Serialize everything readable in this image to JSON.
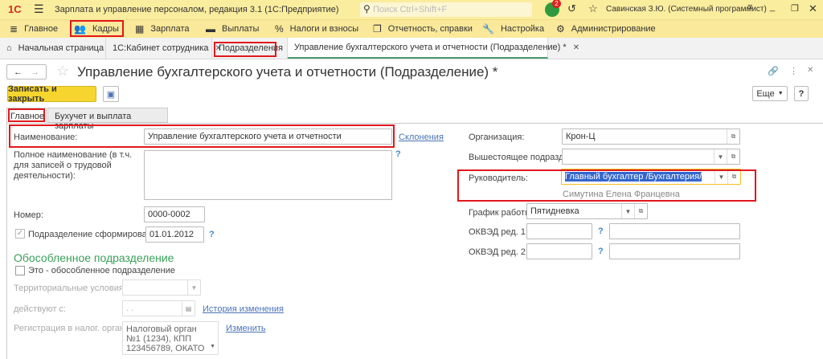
{
  "titlebar": {
    "logo": "1С",
    "title": "Зарплата и управление персоналом, редакция 3.1  (1С:Предприятие)",
    "search_placeholder": "Поиск Ctrl+Shift+F",
    "notifications_count": "2",
    "user": "Савинская З.Ю. (Системный программист)"
  },
  "menu": [
    "Главное",
    "Кадры",
    "Зарплата",
    "Выплаты",
    "Налоги и взносы",
    "Отчетность, справки",
    "Настройка",
    "Администрирование"
  ],
  "tabs": [
    "Начальная страница",
    "1С:Кабинет сотрудника",
    "Подразделения",
    "Управление бухгалтерского учета и отчетности (Подразделение) *"
  ],
  "form": {
    "title": "Управление бухгалтерского учета и отчетности (Подразделение) *",
    "save_close": "Записать и закрыть",
    "more": "Еще",
    "help": "?",
    "subtabs": [
      "Главное",
      "Бухучет и выплата зарплаты"
    ],
    "name_label": "Наименование:",
    "name_value": "Управление бухгалтерского учета и отчетности",
    "declensions": "Склонения",
    "fullname_label": "Полное наименование (в т.ч. для записей о трудовой деятельности):",
    "fullname_value": "",
    "number_label": "Номер:",
    "number_value": "0000-0002",
    "formed_label": "Подразделение сформировано",
    "formed_date": "01.01.2012",
    "separate_header": "Обособленное подразделение",
    "separate_checkbox": "Это - обособленное подразделение",
    "territorial_label": "Территориальные условия:",
    "valid_from_label": "действуют с:",
    "valid_from_value": " .  .",
    "history_link": "История изменения",
    "tax_reg_label": "Регистрация в налог. органе:",
    "tax_reg_value": "Налоговый орган №1 (1234), КПП 123456789, ОКАТО",
    "change_link": "Изменить",
    "org_label": "Организация:",
    "org_value": "Крон-Ц",
    "parent_label": "Вышестоящее подразд.:",
    "parent_value": "",
    "head_label": "Руководитель:",
    "head_value": "Главный бухгалтер /Бухгалтерия/",
    "head_person": "Симутина Елена Францевна",
    "schedule_label": "График работы:",
    "schedule_value": "Пятидневка",
    "okved1_label": "ОКВЭД ред. 1:",
    "okved2_label": "ОКВЭД ред. 2:",
    "qmark": "?"
  }
}
